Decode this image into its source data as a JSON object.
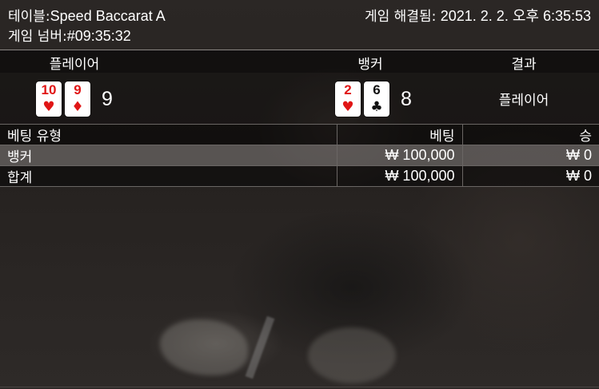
{
  "header": {
    "table_label": "테이블:",
    "table_name": "Speed Baccarat A",
    "round_label": "게임 넘버:",
    "round_id": "#09:35:32",
    "resolved_label": "게임 해결됨:",
    "resolved_time": "2021. 2. 2. 오후 6:35:53"
  },
  "result": {
    "player_label": "플레이어",
    "banker_label": "뱅커",
    "result_label": "결과",
    "player_cards": [
      {
        "rank": "10",
        "suit": "♥",
        "color": "#e01616"
      },
      {
        "rank": "9",
        "suit": "♦",
        "color": "#e01616"
      }
    ],
    "player_score": "9",
    "banker_cards": [
      {
        "rank": "2",
        "suit": "♥",
        "color": "#e01616"
      },
      {
        "rank": "6",
        "suit": "♣",
        "color": "#111111"
      }
    ],
    "banker_score": "8",
    "winner": "플레이어"
  },
  "bets": {
    "headers": [
      "베팅 유형",
      "베팅",
      "승"
    ],
    "rows": [
      {
        "type": "뱅커",
        "bet": "₩ 100,000",
        "win": "₩ 0"
      }
    ],
    "total": {
      "type": "합계",
      "bet": "₩ 100,000",
      "win": "₩ 0"
    }
  }
}
